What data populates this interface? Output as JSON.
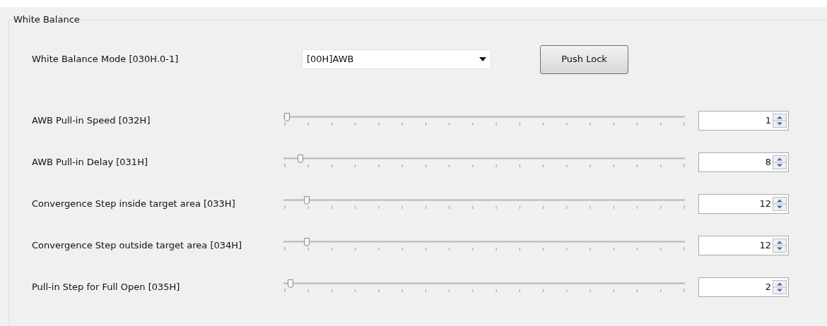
{
  "group": {
    "title": "White Balance"
  },
  "mode": {
    "label": "White Balance Mode [030H.0-1]",
    "value": "[00H]AWB",
    "button": "Push Lock"
  },
  "sliders": [
    {
      "label": "AWB Pull-in Speed [032H]",
      "level": 0.005,
      "value": "1"
    },
    {
      "label": "AWB Pull-in Delay [031H]",
      "level": 0.04,
      "value": "8"
    },
    {
      "label": "Convergence Step inside target area [033H]",
      "level": 0.055,
      "value": "12"
    },
    {
      "label": "Convergence Step outside target area [034H]",
      "level": 0.055,
      "value": "12"
    },
    {
      "label": "Pull-in Step for Full Open [035H]",
      "level": 0.015,
      "value": "2"
    }
  ]
}
